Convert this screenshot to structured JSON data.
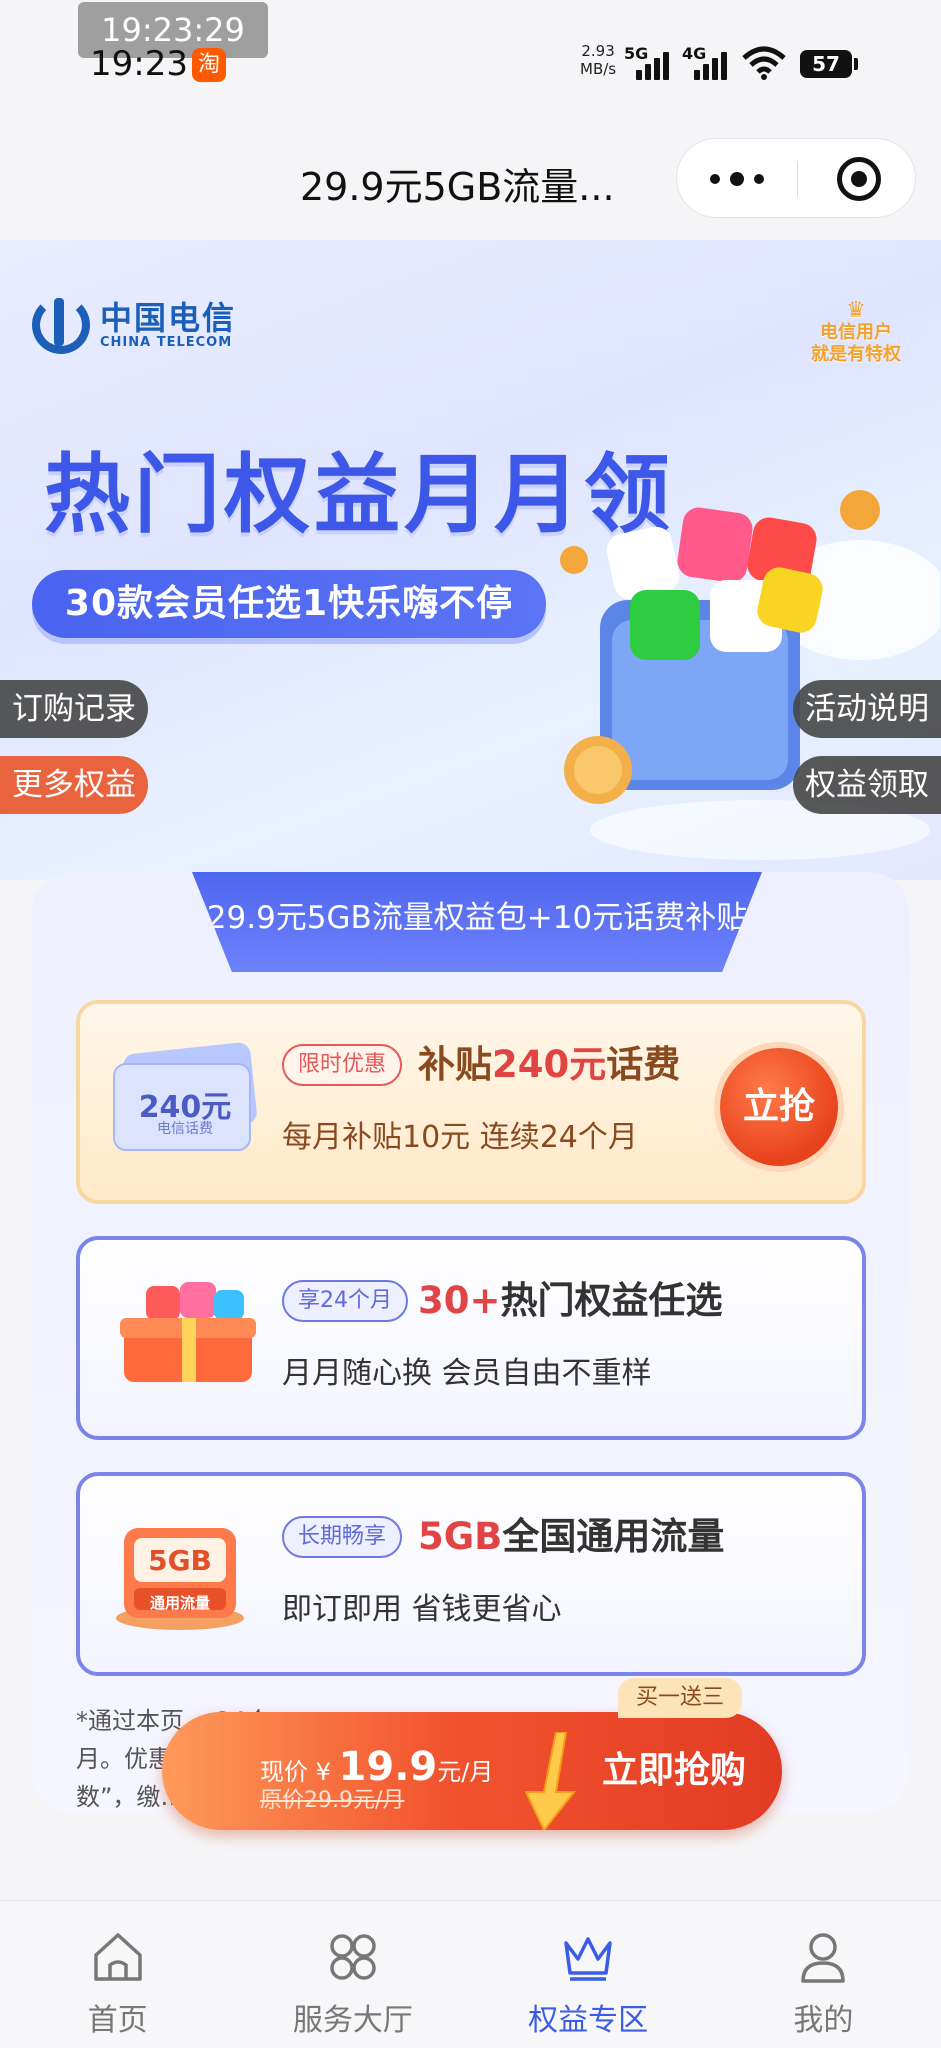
{
  "status_bar": {
    "time_overlay": "19:23:29",
    "time": "19:23",
    "app_icon_glyph": "淘",
    "net_speed_value": "2.93",
    "net_speed_unit": "MB/s",
    "sim1": "5G",
    "sim2": "4G",
    "battery": "57"
  },
  "title_bar": {
    "title": "29.9元5GB流量..."
  },
  "hero": {
    "brand_cn": "中国电信",
    "brand_en": "CHINA TELECOM",
    "badge_line1": "电信用户",
    "badge_line2": "就是有特权",
    "title": "热门权益月月领",
    "pill": "30款会员任选1快乐嗨不停",
    "tabs": {
      "orders": "订购记录",
      "more": "更多权益",
      "rules": "活动说明",
      "claim": "权益领取"
    }
  },
  "product": {
    "header": "29.9元5GB流量权益包+10元话费补贴",
    "offers": [
      {
        "pic_label": "240元",
        "pic_sub": "电信话费",
        "tag": "限时优惠",
        "headline_pre": "补贴",
        "headline_hl": "240元",
        "headline_post": "话费",
        "sub": "每月补贴10元 连续24个月",
        "button": "立抢"
      },
      {
        "tag": "享24个月",
        "headline_hl": "30+",
        "headline_post": "热门权益任选",
        "sub": "月月随心换  会员自由不重样"
      },
      {
        "pic_label": "5GB",
        "pic_sub": "通用流量",
        "tag": "长期畅享",
        "headline_hl": "5GB",
        "headline_post": "全国通用流量",
        "sub": "即订即用   省钱更省心"
      }
    ],
    "disclaimer_line1": "*通过本页…                                                                   24个",
    "disclaimer_line2": "月。优惠…                                                                     份",
    "disclaimer_line3": "数”，缴…"
  },
  "buy_bar": {
    "gift": "买一送三",
    "now_prefix": "现价 ¥ ",
    "price": "19.9",
    "unit": "元/月",
    "original": "原价29.9元/月",
    "button": "立即抢购"
  },
  "bottom_nav": {
    "items": [
      {
        "label": "首页",
        "icon": "home-icon"
      },
      {
        "label": "服务大厅",
        "icon": "service-hall-icon"
      },
      {
        "label": "权益专区",
        "icon": "crown-icon"
      },
      {
        "label": "我的",
        "icon": "user-icon"
      }
    ],
    "active_index": 2
  },
  "colors": {
    "brand_blue": "#3d57e8",
    "accent_red": "#e04444",
    "nav_active": "#3b5ce6"
  }
}
